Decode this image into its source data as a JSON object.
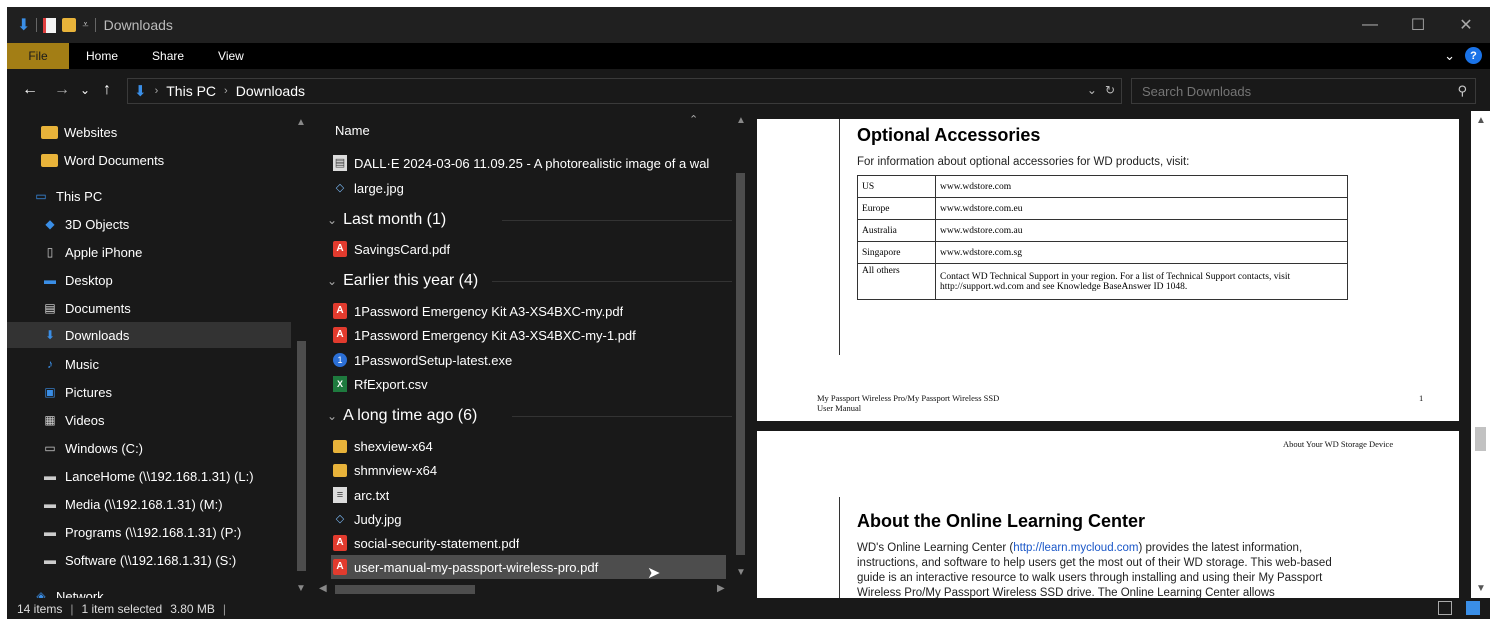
{
  "window": {
    "title": "Downloads"
  },
  "window_controls": {
    "minimize": "—",
    "maximize": "☐",
    "close": "✕"
  },
  "ribbon": {
    "tabs": [
      "File",
      "Home",
      "Share",
      "View"
    ]
  },
  "address": {
    "back": "←",
    "forward": "→",
    "recent": "⌄",
    "up": "↑",
    "crumbs": [
      "This PC",
      "Downloads"
    ]
  },
  "search": {
    "placeholder": "Search Downloads"
  },
  "nav": {
    "items": [
      {
        "label": "Websites",
        "icon": "folder-icon"
      },
      {
        "label": "Word Documents",
        "icon": "folder-icon"
      },
      {
        "label": "This PC",
        "icon": "computer-icon"
      },
      {
        "label": "3D Objects",
        "icon": "3d-objects-icon"
      },
      {
        "label": "Apple iPhone",
        "icon": "phone-icon"
      },
      {
        "label": "Desktop",
        "icon": "desktop-icon"
      },
      {
        "label": "Documents",
        "icon": "documents-icon"
      },
      {
        "label": "Downloads",
        "icon": "download-icon",
        "selected": true
      },
      {
        "label": "Music",
        "icon": "music-icon"
      },
      {
        "label": "Pictures",
        "icon": "pictures-icon"
      },
      {
        "label": "Videos",
        "icon": "videos-icon"
      },
      {
        "label": "Windows (C:)",
        "icon": "drive-icon"
      },
      {
        "label": "LanceHome (\\\\192.168.1.31) (L:)",
        "icon": "network-drive-icon"
      },
      {
        "label": "Media (\\\\192.168.1.31) (M:)",
        "icon": "network-drive-icon"
      },
      {
        "label": "Programs (\\\\192.168.1.31) (P:)",
        "icon": "network-drive-icon"
      },
      {
        "label": "Software (\\\\192.168.1.31) (S:)",
        "icon": "network-drive-icon"
      },
      {
        "label": "Network",
        "icon": "network-icon"
      }
    ]
  },
  "files": {
    "column_header": "Name",
    "rows": [
      {
        "name": "DALL·E 2024-03-06 11.09.25 - A photorealistic image of a wal",
        "icon": "image-file-icon"
      },
      {
        "name": "large.jpg",
        "icon": "jpg-icon"
      },
      {
        "group": "Last month (1)"
      },
      {
        "name": "SavingsCard.pdf",
        "icon": "pdf-icon"
      },
      {
        "group": "Earlier this year (4)"
      },
      {
        "name": "1Password Emergency Kit A3-XS4BXC-my.pdf",
        "icon": "pdf-icon"
      },
      {
        "name": "1Password Emergency Kit A3-XS4BXC-my-1.pdf",
        "icon": "pdf-icon"
      },
      {
        "name": "1PasswordSetup-latest.exe",
        "icon": "exe-icon"
      },
      {
        "name": "RfExport.csv",
        "icon": "csv-icon"
      },
      {
        "group": "A long time ago (6)"
      },
      {
        "name": "shexview-x64",
        "icon": "folder-icon"
      },
      {
        "name": "shmnview-x64",
        "icon": "folder-icon"
      },
      {
        "name": "arc.txt",
        "icon": "txt-icon"
      },
      {
        "name": "Judy.jpg",
        "icon": "jpg-icon"
      },
      {
        "name": "social-security-statement.pdf",
        "icon": "pdf-icon"
      },
      {
        "name": "user-manual-my-passport-wireless-pro.pdf",
        "icon": "pdf-icon",
        "selected": true
      }
    ]
  },
  "preview": {
    "page1": {
      "heading": "Optional Accessories",
      "intro": "For information about optional accessories for WD products, visit:",
      "table": [
        {
          "k": "US",
          "v": "www.wdstore.com"
        },
        {
          "k": "Europe",
          "v": "www.wdstore.com.eu"
        },
        {
          "k": "Australia",
          "v": "www.wdstore.com.au"
        },
        {
          "k": "Singapore",
          "v": "www.wdstore.com.sg"
        },
        {
          "k": "All others",
          "v": "Contact WD Technical Support in your region. For a list of Technical Support contacts, visit http://support.wd.com and see Knowledge BaseAnswer ID 1048."
        }
      ],
      "footer_left_1": "My Passport Wireless Pro/My Passport Wireless SSD",
      "footer_left_2": "User Manual",
      "page_number": "1"
    },
    "page2": {
      "header_right": "About Your WD Storage Device",
      "heading": "About the Online Learning Center",
      "para_before_link": "WD's Online Learning Center (",
      "link": "http://learn.mycloud.com",
      "para_after_link": ") provides the latest information, instructions, and software to help users get the most out of their WD storage. This web-based guide is an interactive resource to walk users through installing and using their My Passport Wireless Pro/My Passport Wireless SSD drive. The Online Learning Center allows"
    }
  },
  "status": {
    "item_count": "14 items",
    "selection": "1 item selected",
    "size": "3.80 MB"
  },
  "colors": {
    "file_tab": "#a37e15",
    "accent": "#3a8ee6",
    "pdf": "#e23b2e",
    "folder": "#e8b33a"
  }
}
